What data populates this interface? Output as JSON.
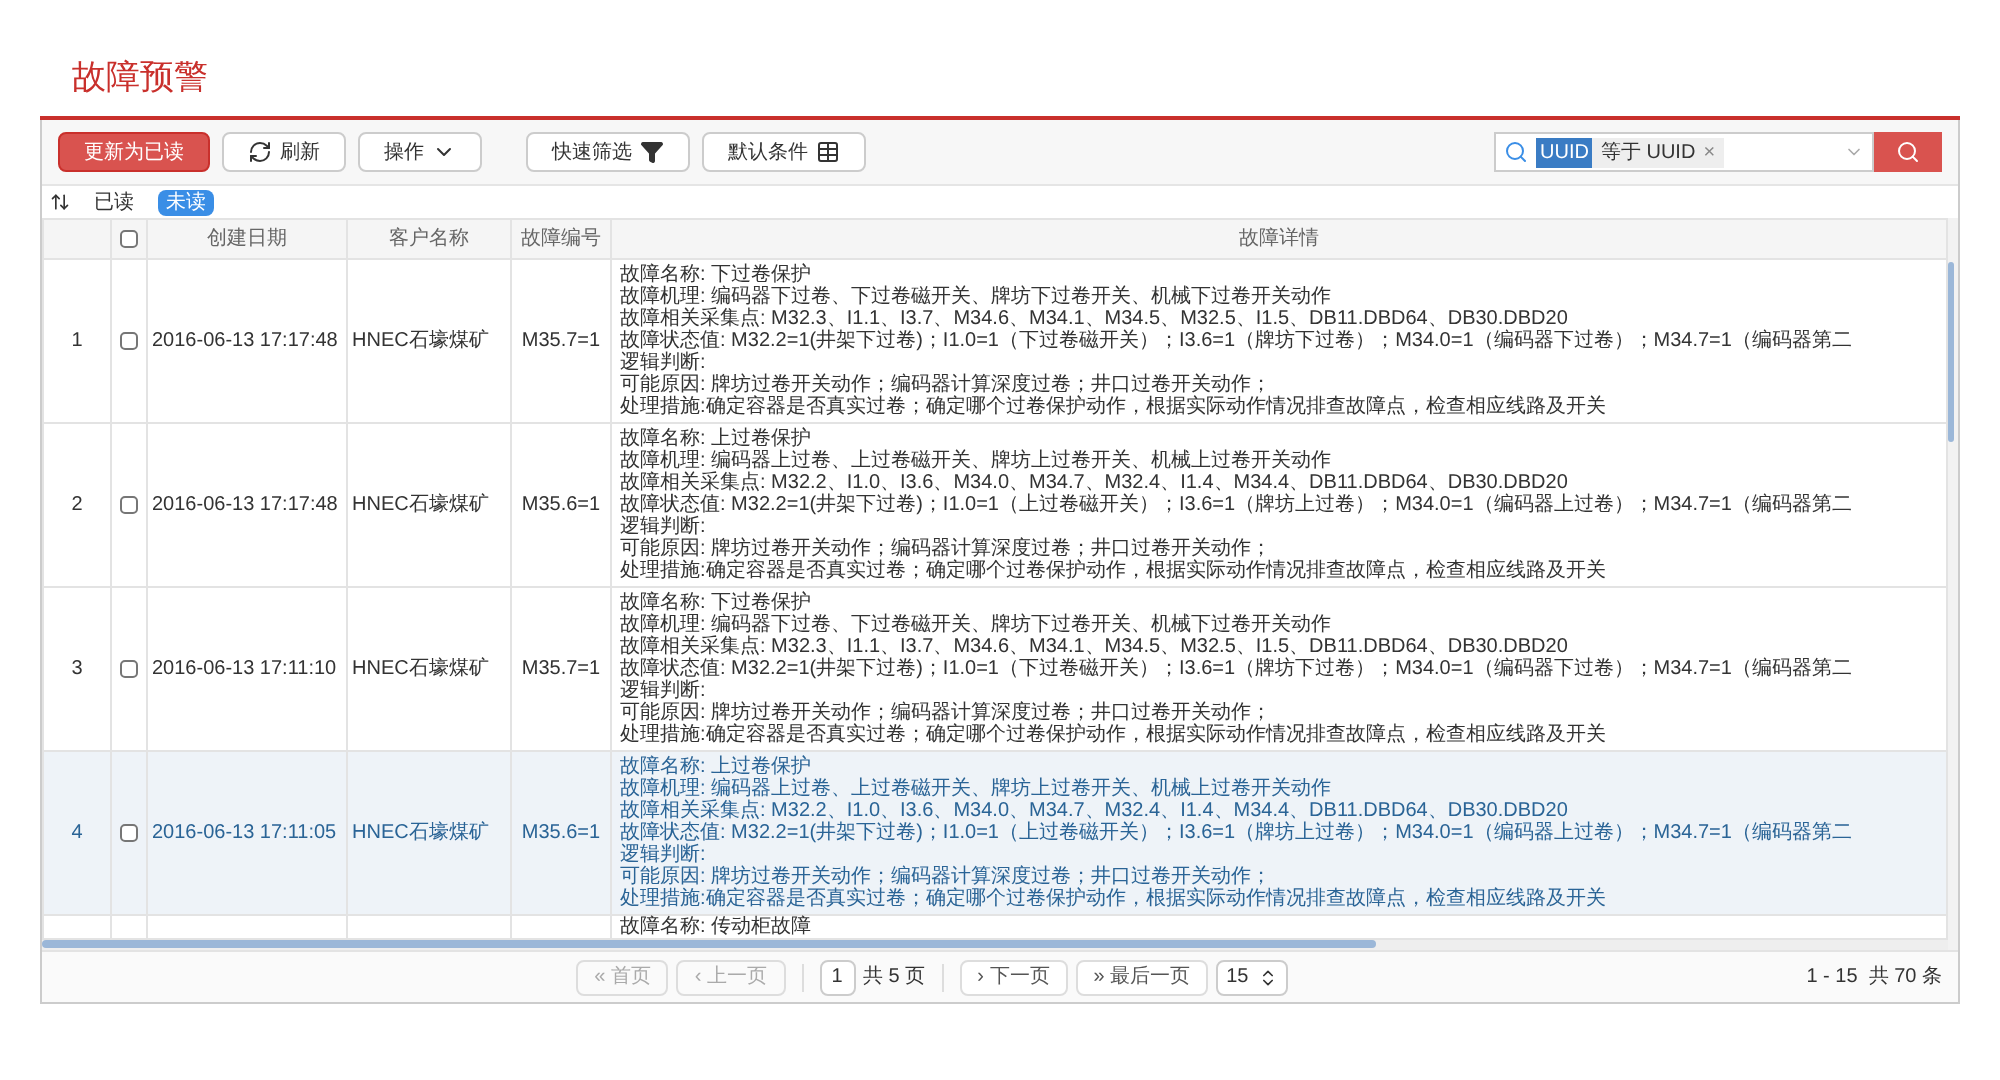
{
  "page_title": "故障预警",
  "toolbar": {
    "buttons": [
      {
        "label": "更新为已读",
        "kind": "primary"
      },
      {
        "label": "刷新",
        "kind": "refresh"
      },
      {
        "label": "操作",
        "kind": "dropdown"
      },
      {
        "label": "快速筛选",
        "kind": "filter"
      },
      {
        "label": "默认条件",
        "kind": "conditions"
      }
    ],
    "search": {
      "tag_key": "UUID",
      "tag_text": "等于 UUID",
      "remove": "×"
    }
  },
  "read_filter": [
    {
      "label": "已读",
      "selected": false
    },
    {
      "label": "未读",
      "selected": true
    }
  ],
  "table": {
    "select_all": {
      "checked": false
    },
    "columns": [
      "创建日期",
      "客户名称",
      "故障编号",
      "故障详情"
    ],
    "rows": [
      {
        "index": "1",
        "checked": false,
        "selected": false,
        "date": "2016-06-13 17:17:48",
        "customer": "HNEC石壕煤矿",
        "code": "M35.7=1",
        "details": [
          "故障名称: 下过卷保护",
          "故障机理: 编码器下过卷、下过卷磁开关、牌坊下过卷开关、机械下过卷开关动作",
          "故障相关采集点: M32.3、I1.1、I3.7、M34.6、M34.1、M34.5、M32.5、I1.5、DB11.DBD64、DB30.DBD20",
          "故障状态值: M32.2=1(井架下过卷)；I1.0=1（下过卷磁开关）；I3.6=1（牌坊下过卷）；M34.0=1（编码器下过卷）；M34.7=1（编码器第二",
          "逻辑判断:",
          "可能原因: 牌坊过卷开关动作；编码器计算深度过卷；井口过卷开关动作；",
          "处理措施:确定容器是否真实过卷；确定哪个过卷保护动作，根据实际动作情况排查故障点，检查相应线路及开关"
        ]
      },
      {
        "index": "2",
        "checked": false,
        "selected": false,
        "date": "2016-06-13 17:17:48",
        "customer": "HNEC石壕煤矿",
        "code": "M35.6=1",
        "details": [
          "故障名称: 上过卷保护",
          "故障机理: 编码器上过卷、上过卷磁开关、牌坊上过卷开关、机械上过卷开关动作",
          "故障相关采集点: M32.2、I1.0、I3.6、M34.0、M34.7、M32.4、I1.4、M34.4、DB11.DBD64、DB30.DBD20",
          "故障状态值: M32.2=1(井架下过卷)；I1.0=1（上过卷磁开关）；I3.6=1（牌坊上过卷）；M34.0=1（编码器上过卷）；M34.7=1（编码器第二",
          "逻辑判断:",
          "可能原因: 牌坊过卷开关动作；编码器计算深度过卷；井口过卷开关动作；",
          "处理措施:确定容器是否真实过卷；确定哪个过卷保护动作，根据实际动作情况排查故障点，检查相应线路及开关"
        ]
      },
      {
        "index": "3",
        "checked": false,
        "selected": false,
        "date": "2016-06-13 17:11:10",
        "customer": "HNEC石壕煤矿",
        "code": "M35.7=1",
        "details": [
          "故障名称: 下过卷保护",
          "故障机理: 编码器下过卷、下过卷磁开关、牌坊下过卷开关、机械下过卷开关动作",
          "故障相关采集点: M32.3、I1.1、I3.7、M34.6、M34.1、M34.5、M32.5、I1.5、DB11.DBD64、DB30.DBD20",
          "故障状态值: M32.2=1(井架下过卷)；I1.0=1（下过卷磁开关）；I3.6=1（牌坊下过卷）；M34.0=1（编码器下过卷）；M34.7=1（编码器第二",
          "逻辑判断:",
          "可能原因: 牌坊过卷开关动作；编码器计算深度过卷；井口过卷开关动作；",
          "处理措施:确定容器是否真实过卷；确定哪个过卷保护动作，根据实际动作情况排查故障点，检查相应线路及开关"
        ]
      },
      {
        "index": "4",
        "checked": false,
        "selected": true,
        "date": "2016-06-13 17:11:05",
        "customer": "HNEC石壕煤矿",
        "code": "M35.6=1",
        "details": [
          "故障名称: 上过卷保护",
          "故障机理: 编码器上过卷、上过卷磁开关、牌坊上过卷开关、机械上过卷开关动作",
          "故障相关采集点: M32.2、I1.0、I3.6、M34.0、M34.7、M32.4、I1.4、M34.4、DB11.DBD64、DB30.DBD20",
          "故障状态值: M32.2=1(井架下过卷)；I1.0=1（上过卷磁开关）；I3.6=1（牌坊上过卷）；M34.0=1（编码器上过卷）；M34.7=1（编码器第二",
          "逻辑判断:",
          "可能原因: 牌坊过卷开关动作；编码器计算深度过卷；井口过卷开关动作；",
          "处理措施:确定容器是否真实过卷；确定哪个过卷保护动作，根据实际动作情况排查故障点，检查相应线路及开关"
        ]
      },
      {
        "selected": false,
        "details": [
          "故障名称: 传动柜故障"
        ]
      }
    ]
  },
  "pagination": {
    "first": {
      "label": "« 首页",
      "disabled": true
    },
    "prev": {
      "label": "‹ 上一页",
      "disabled": true
    },
    "page": "1",
    "total_pages": "共 5 页",
    "next": {
      "label": "› 下一页",
      "disabled": false
    },
    "last": {
      "label": "» 最后一页",
      "disabled": false
    },
    "page_size": "15",
    "summary": "1 - 15  共 70 条"
  }
}
